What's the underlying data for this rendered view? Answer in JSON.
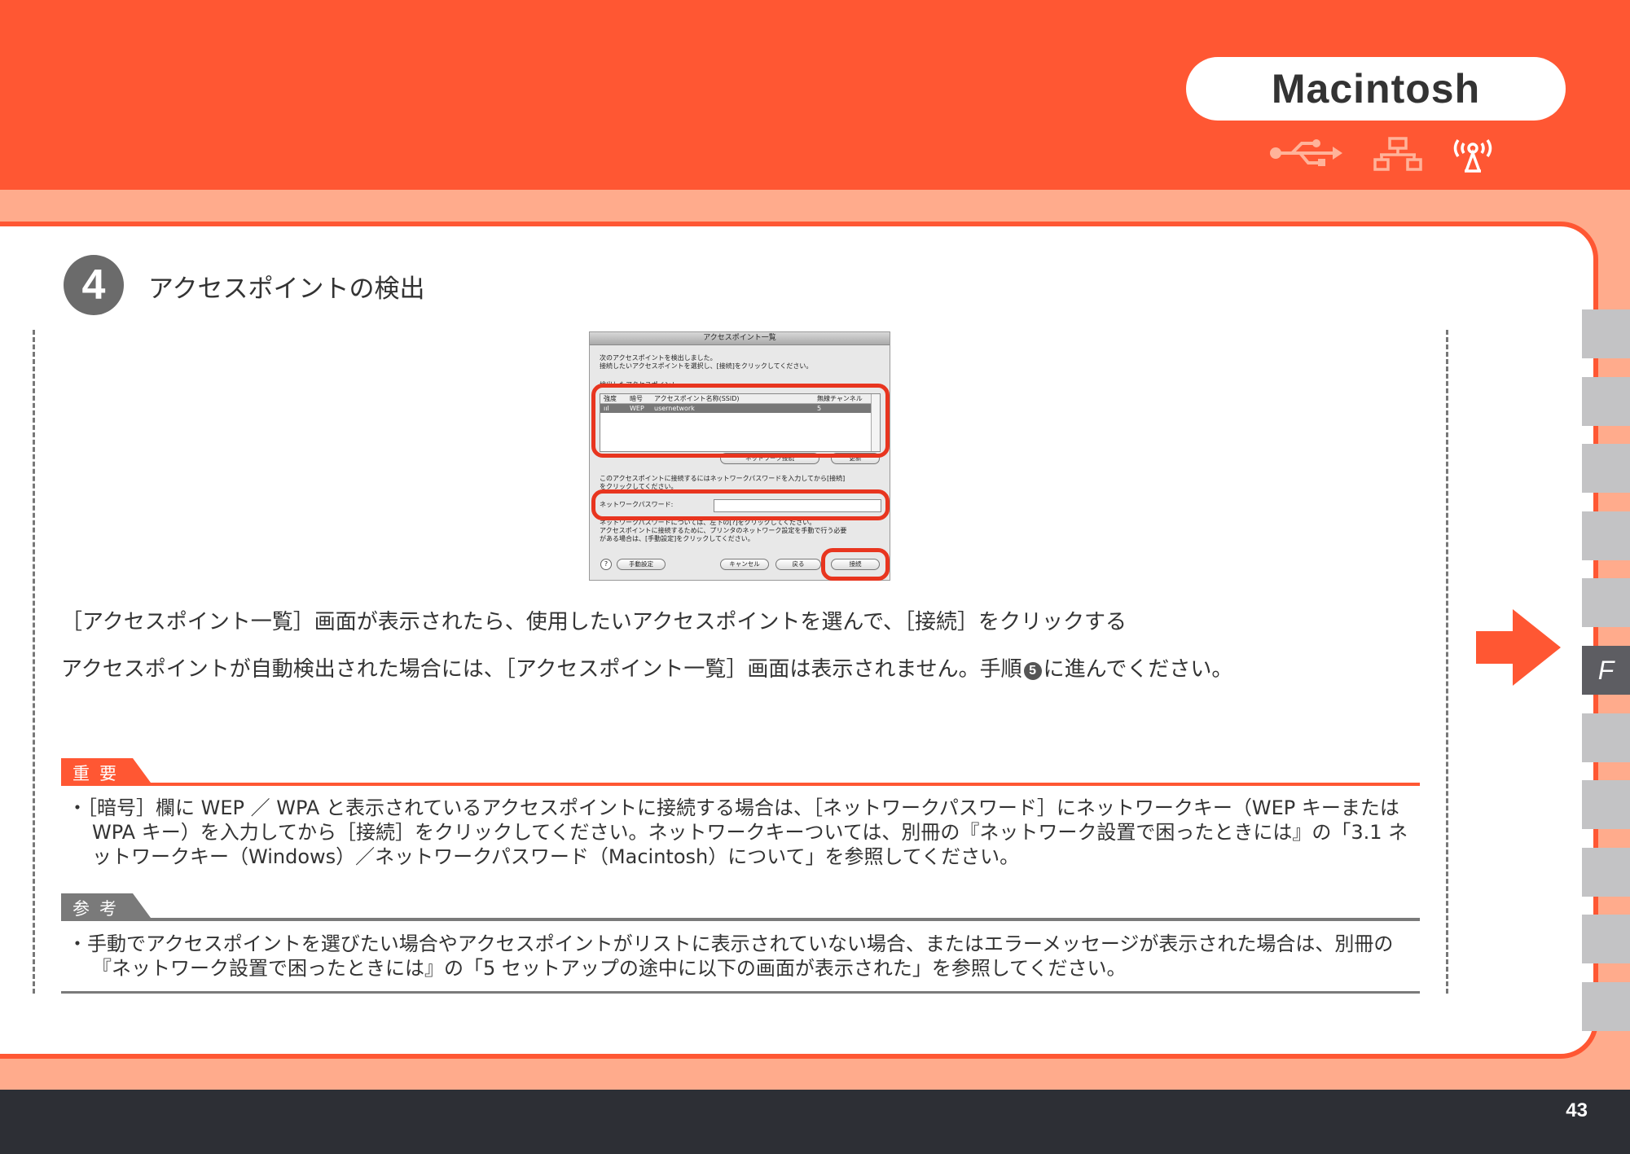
{
  "header": {
    "os_label": "Macintosh",
    "connection_icons": [
      "usb-icon",
      "wired-lan-icon",
      "wireless-lan-icon"
    ],
    "colors": {
      "brand": "#ff5733",
      "band": "#ffab8c",
      "footer": "#2d2f35"
    }
  },
  "step": {
    "number": "4",
    "title": "アクセスポイントの検出"
  },
  "dialog": {
    "title": "アクセスポイント一覧",
    "intro_line1": "次のアクセスポイントを検出しました。",
    "intro_line2": "接続したいアクセスポイントを選択し、[接続]をクリックしてください。",
    "list_label": "検出したアクセスポイント:",
    "columns": [
      "強度",
      "暗号",
      "アクセスポイント名称(SSID)",
      "無線チャンネル"
    ],
    "rows": [
      {
        "strength": "ııl",
        "encryption": "WEP",
        "ssid": "usernetwork",
        "channel": "5"
      }
    ],
    "detail_button": "ネットワーク接続",
    "refresh_button": "更新",
    "pwd_instruction_line1": "このアクセスポイントに接続するにはネットワークパスワードを入力してから[接続]",
    "pwd_instruction_line2": "をクリックしてください。",
    "pwd_label": "ネットワークパスワード:",
    "pwd_value": "",
    "note_line1": "ネットワークパスワードについては、左下の[?]をクリックしてください。",
    "note_line2": "アクセスポイントに接続するために、プリンタのネットワーク設定を手動で行う必要",
    "note_line3": "がある場合は、[手動設定]をクリックしてください。",
    "help_glyph": "?",
    "manual_button": "手動設定",
    "cancel_button": "キャンセル",
    "back_button": "戻る",
    "connect_button": "接続"
  },
  "body": {
    "instruction": "［アクセスポイント一覧］画面が表示されたら、使用したいアクセスポイントを選んで、［接続］をクリックする",
    "auto_note_before": "アクセスポイントが自動検出された場合には、［アクセスポイント一覧］画面は表示されません。手順",
    "auto_note_step": "5",
    "auto_note_after": "に進んでください。"
  },
  "important": {
    "label": "重要",
    "text": "・［暗号］欄に WEP ／ WPA と表示されているアクセスポイントに接続する場合は、［ネットワークパスワード］にネットワークキー（WEP キーまたは WPA キー）を入力してから［接続］をクリックしてください。ネットワークキーついては、別冊の『ネットワーク設置で困ったときには』の「3.1 ネットワークキー（Windows）／ネットワークパスワード（Macintosh）について」を参照してください。"
  },
  "reference": {
    "label": "参考",
    "text": "・手動でアクセスポイントを選びたい場合やアクセスポイントがリストに表示されていない場合、またはエラーメッセージが表示された場合は、別冊の『ネットワーク設置で困ったときには』の「5 セットアップの途中に以下の画面が表示された」を参照してください。"
  },
  "side_nav": {
    "active_label": "F"
  },
  "footer": {
    "page_number": "43"
  }
}
